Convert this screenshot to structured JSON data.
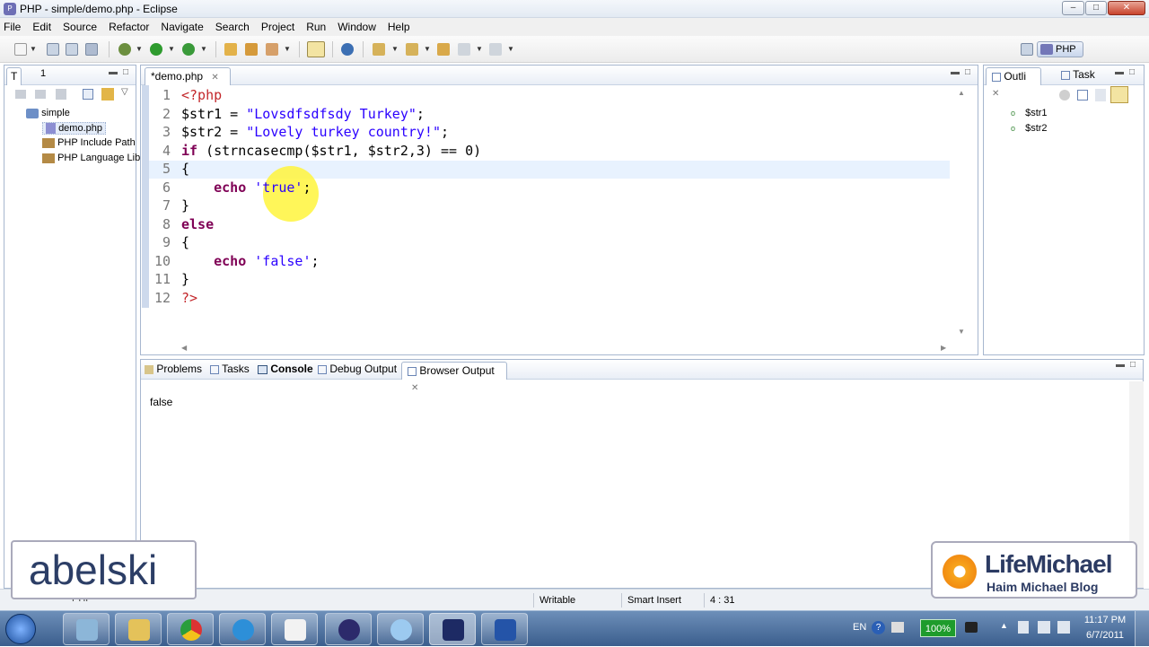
{
  "window": {
    "title": "PHP - simple/demo.php - Eclipse",
    "min": "–",
    "max": "□",
    "close": "✕"
  },
  "menu": [
    "File",
    "Edit",
    "Source",
    "Refactor",
    "Navigate",
    "Search",
    "Project",
    "Run",
    "Window",
    "Help"
  ],
  "toolbar": {
    "perspective_label": "PHP"
  },
  "left_panel": {
    "tabs": [
      "T",
      "1"
    ],
    "tree": {
      "project": "simple",
      "items": [
        "demo.php",
        "PHP Include Path",
        "PHP Language Library"
      ]
    }
  },
  "editor": {
    "tab_label": "*demo.php",
    "lines": [
      {
        "num": "1"
      },
      {
        "num": "2"
      },
      {
        "num": "3"
      },
      {
        "num": "4"
      },
      {
        "num": "5"
      },
      {
        "num": "6"
      },
      {
        "num": "7"
      },
      {
        "num": "8"
      },
      {
        "num": "9"
      },
      {
        "num": "10"
      },
      {
        "num": "11"
      },
      {
        "num": "12"
      }
    ],
    "code": {
      "l1": "<?php",
      "l2a": "$str1 = ",
      "l2b": "\"Lovsdfsdfsdy Turkey\"",
      "l2c": ";",
      "l3a": "$str2 = ",
      "l3b": "\"Lovely turkey country!\"",
      "l3c": ";",
      "l4a": "if",
      "l4b": " (strncasecmp($str1, $str2,3) == 0)",
      "l5": "{",
      "l6a": "    ",
      "l6b": "echo",
      "l6c": " ",
      "l6d": "'true'",
      "l6e": ";",
      "l7": "}",
      "l8": "else",
      "l9": "{",
      "l10a": "    ",
      "l10b": "echo",
      "l10c": " ",
      "l10d": "'false'",
      "l10e": ";",
      "l11": "}",
      "l12": "?>"
    }
  },
  "right_panel": {
    "tabs": [
      "Outli",
      "Task"
    ],
    "items": [
      "$str1",
      "$str2"
    ]
  },
  "bottom_panel": {
    "tabs": [
      "Problems",
      "Tasks",
      "Console",
      "Debug Output",
      "Browser Output"
    ],
    "output": "false"
  },
  "status": {
    "left": "PHP",
    "writable": "Writable",
    "insert": "Smart Insert",
    "position": "4 : 31"
  },
  "taskbar": {
    "lang": "EN",
    "battery": "100%",
    "time": "11:17 PM",
    "date": "6/7/2011"
  },
  "watermarks": {
    "left": "abelski",
    "right_title": "LifeMichael",
    "right_sub": "Haim Michael Blog"
  },
  "colors": {
    "keyword": "#7f0055",
    "string": "#2a00ff",
    "php_tag": "#c3272b",
    "highlight": "#fff53c"
  }
}
